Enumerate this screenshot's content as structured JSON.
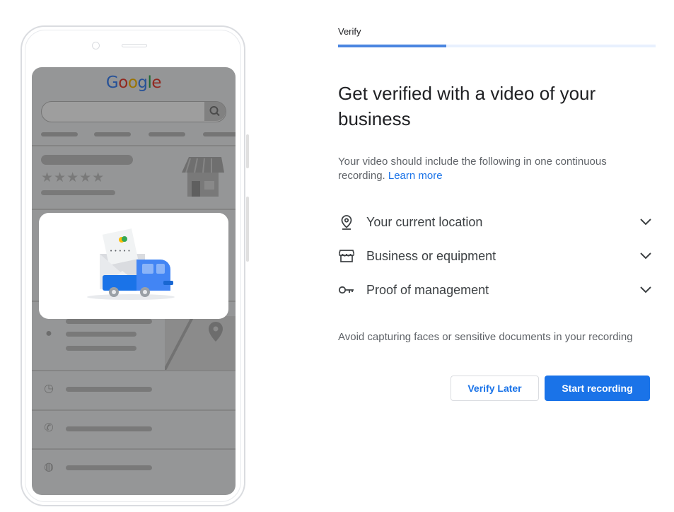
{
  "illustration": {
    "logo_letters": [
      {
        "char": "G",
        "color": "#4285f4"
      },
      {
        "char": "o",
        "color": "#ea4335"
      },
      {
        "char": "o",
        "color": "#fbbc05"
      },
      {
        "char": "g",
        "color": "#4285f4"
      },
      {
        "char": "l",
        "color": "#34a853"
      },
      {
        "char": "e",
        "color": "#ea4335"
      }
    ],
    "stars": "★★★★★"
  },
  "header": {
    "step_label": "Verify",
    "progress": 0.34
  },
  "main": {
    "title": "Get verified with a video of your business",
    "intro_text": "Your video should include the following in one continuous recording.",
    "learn_more_label": "Learn more",
    "requirements": [
      {
        "label": "Your current location",
        "icon": "location-pin-icon"
      },
      {
        "label": "Business or equipment",
        "icon": "storefront-icon"
      },
      {
        "label": "Proof of management",
        "icon": "key-icon"
      }
    ],
    "note": "Avoid capturing faces or sensitive documents in your recording"
  },
  "actions": {
    "verify_later_label": "Verify Later",
    "start_recording_label": "Start recording"
  },
  "colors": {
    "accent": "#1a73e8",
    "progress_fill": "#4a85e0",
    "progress_track": "#e8f0fe"
  }
}
